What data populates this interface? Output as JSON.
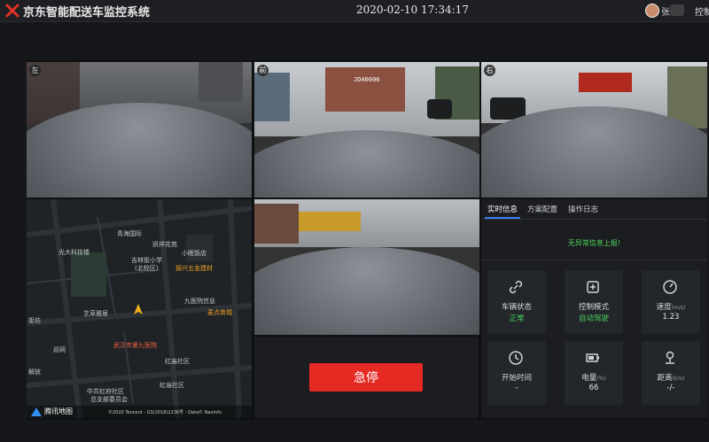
{
  "header": {
    "app_title": "京东智能配送车监控系统",
    "datetime": "2020-02-10 17:34:17",
    "user_name": "张",
    "nav_control": "控制"
  },
  "cameras": {
    "left": {
      "label": "左"
    },
    "front": {
      "label": "前",
      "plate_text": "JD40006"
    },
    "right": {
      "label": "右"
    }
  },
  "map": {
    "brand": "腾讯地图",
    "copyright": "©2020 Tencent - GS(2018)2236号 - Data© NavInfo",
    "labels": {
      "guangda": "光大科技楼",
      "qinghai": "青海国际",
      "kaixiang": "凯祥花苑",
      "xiaomian": "小眠饭店",
      "jilinjie": "吉林街小学",
      "jilinjie_sub": "(北校区)",
      "zhenxing": "振兴五金建材",
      "jiefang": "解放",
      "yingtai": "芝草雅居",
      "jiuyuan": "九医院信息",
      "jiedian": "麦点商城",
      "jiefang2": "街坊",
      "xunwu": "巡网",
      "wuhan9": "武汉市第九医院",
      "hongmiao": "红庙社区",
      "zhongshan": "中共虹府社区",
      "zongzhi": "总支部委员会",
      "hongmiao2": "虹庙社区"
    }
  },
  "controls": {
    "emergency_stop": "急停"
  },
  "info_panel": {
    "tabs": [
      "实时信息",
      "方案配置",
      "操作日志"
    ],
    "active_tab": 0,
    "alert_text": "无异常信息上报!",
    "cards": {
      "vehicle_status": {
        "label": "车辆状态",
        "value": "正常"
      },
      "control_mode": {
        "label": "控制模式",
        "value": "自动驾驶"
      },
      "speed": {
        "label": "速度",
        "unit": "(m/s)",
        "value": "1.23"
      },
      "start_time": {
        "label": "开始时间",
        "value": "-"
      },
      "battery": {
        "label": "电量",
        "unit": "(%)",
        "value": "66"
      },
      "distance": {
        "label": "距离",
        "unit": "(km)",
        "value": "-/-"
      }
    }
  },
  "colors": {
    "accent": "#3c7ef0",
    "estop": "#e42a23",
    "ok_green": "#49d05a"
  }
}
